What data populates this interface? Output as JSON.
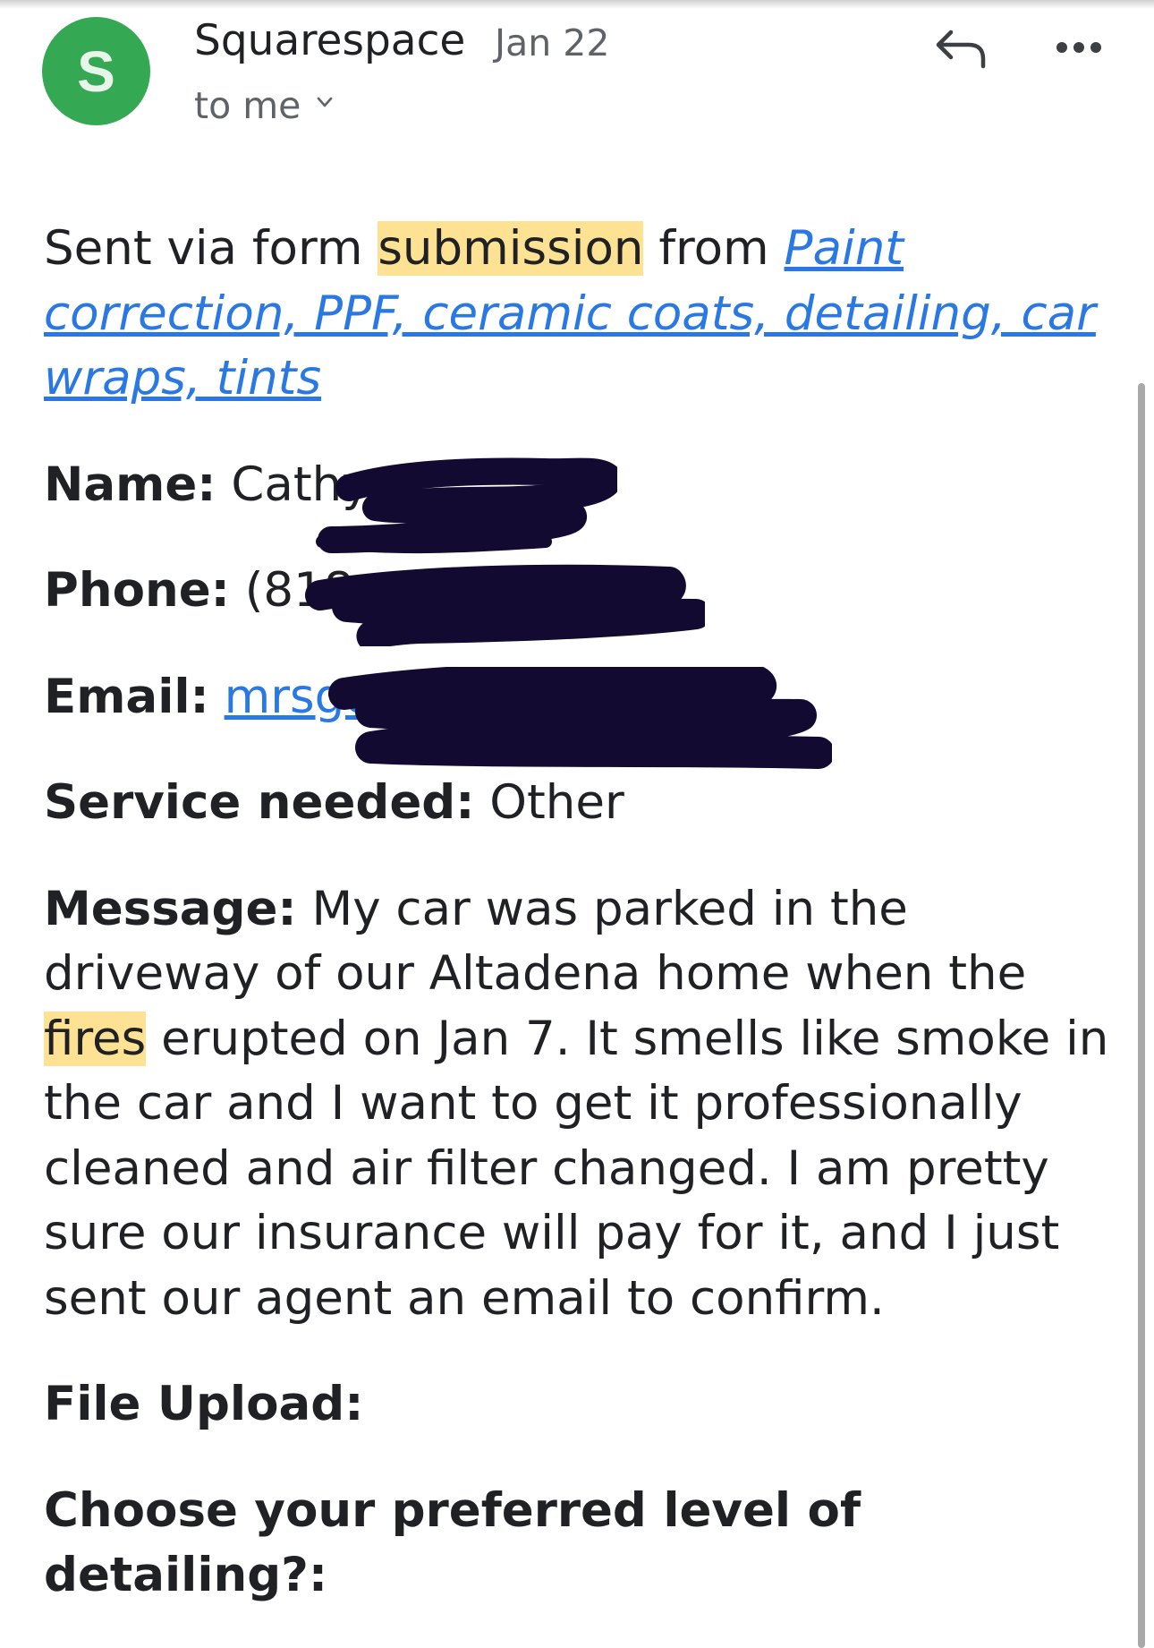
{
  "header": {
    "avatar_letter": "S",
    "sender": "Squarespace",
    "date": "Jan 22",
    "recipient": "to me",
    "icons": [
      "chevron-down-icon",
      "reply-icon",
      "more-icon"
    ]
  },
  "intro": {
    "prefix": "Sent via form ",
    "highlight": "submission",
    "middle": " from ",
    "link": "Paint correction, PPF, ceramic coats, detailing, car wraps, tints"
  },
  "fields": {
    "name_label": "Name:",
    "name_value": "Cathy",
    "phone_label": "Phone:",
    "phone_value": "(818",
    "email_label": "Email:",
    "email_value": "mrsgo",
    "service_label": "Service needed:",
    "service_value": "Other",
    "message_label": "Message:",
    "message_part1": "My car was parked in the driveway of our Altadena home when the",
    "message_highlight": "fires",
    "message_part2": "erupted on Jan 7. It smells like smoke in the car and I want to get it professionally cleaned and air filter changed. I am pretty sure our insurance will pay for it, and I just sent our agent an email to confirm.",
    "upload_label": "File Upload:",
    "detailing_label": "Choose your preferred level of detailing?:"
  },
  "colors": {
    "avatar": "#34a853",
    "link": "#2a78e4",
    "highlight": "#fde293",
    "redaction": "#120a30"
  }
}
